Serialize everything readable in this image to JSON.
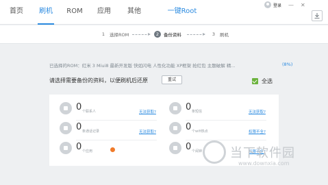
{
  "nav": {
    "tabs": [
      "首页",
      "刷机",
      "ROM",
      "应用",
      "其他"
    ],
    "root_label": "一键Root"
  },
  "user": {
    "login_label": "登录"
  },
  "window": {
    "minimize": "—",
    "close": "✕"
  },
  "steps": [
    {
      "num": "1",
      "label": "选择ROM"
    },
    {
      "num": "2",
      "label": "备份资料"
    },
    {
      "num": "3",
      "label": "刷机"
    }
  ],
  "rom": {
    "selected_text": "已选择的ROM：红米 3 Miui8 最新开发版 快如闪电 人性化功能 XP框架 抢红包 主题破解 精...",
    "percent": "(8%)"
  },
  "backup": {
    "prompt": "请选择需要备份的资料，以便刷机后还原",
    "reset_label": "重试",
    "select_all_label": "全选",
    "items": [
      {
        "count": "0",
        "label": "个联系人",
        "link": "无法获取?",
        "icon": "contact-icon"
      },
      {
        "count": "0",
        "label": "条短信",
        "link": "无法获取?",
        "icon": "sms-icon"
      },
      {
        "count": "0",
        "label": "条通话记录",
        "link": "无法获取?",
        "icon": "phone-icon"
      },
      {
        "count": "0",
        "label": "个wifi热点",
        "link": "权限不全?",
        "icon": "wifi-icon"
      },
      {
        "count": "0",
        "label": "个应用",
        "link": "",
        "icon": "app-icon"
      },
      {
        "count": "0",
        "label": "个闹钟",
        "link": "权限不全?",
        "icon": "alarm-icon"
      }
    ]
  },
  "watermark": {
    "title": "当下软件园",
    "url": "www.downxia.com"
  },
  "colors": {
    "accent": "#2a8ae0",
    "check": "#6cb33e",
    "warning": "#f07b2a"
  }
}
